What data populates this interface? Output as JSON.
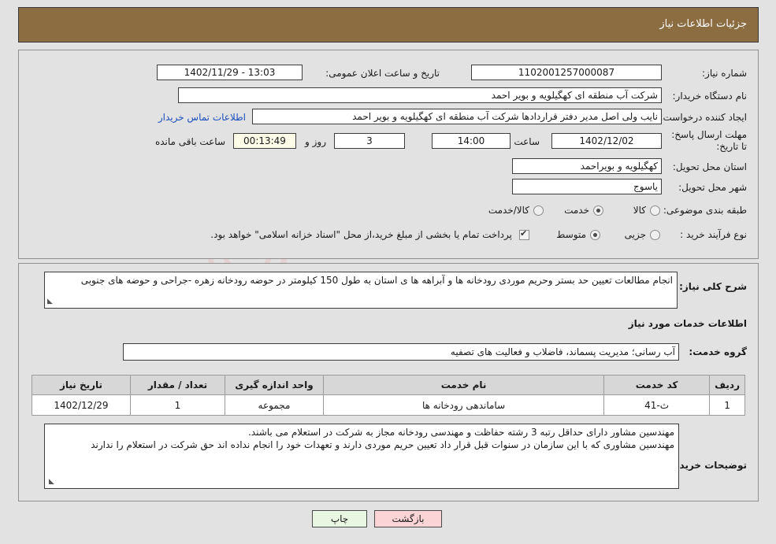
{
  "header": {
    "title": "جزئیات اطلاعات نیاز"
  },
  "watermark": {
    "text": "AriaTender.net"
  },
  "form": {
    "need_number_label": "شماره نیاز:",
    "need_number_value": "1102001257000087",
    "announce_label": "تاریخ و ساعت اعلان عمومی:",
    "announce_value": "13:03 - 1402/11/29",
    "buyer_org_label": "نام دستگاه خریدار:",
    "buyer_org_value": "شرکت آب منطقه ای کهگیلویه و بویر احمد",
    "creator_label": "ایجاد کننده درخواست:",
    "creator_value": "نایب ولی اصل مدیر دفتر قراردادها شرکت آب منطقه ای کهگیلویه و بویر احمد",
    "contact_link": "اطلاعات تماس خریدار",
    "deadline_label": "مهلت ارسال پاسخ: تا تاریخ:",
    "deadline_date": "1402/12/02",
    "hour_label": "ساعت",
    "hour_value": "14:00",
    "days_value": "3",
    "days_label": "روز و",
    "countdown_value": "00:13:49",
    "remaining_label": "ساعت باقی مانده",
    "province_label": "استان محل تحویل:",
    "province_value": "کهگیلویه و بویراحمد",
    "city_label": "شهر محل تحویل:",
    "city_value": "یاسوج",
    "category_label": "طبقه بندی موضوعی:",
    "category_options": [
      {
        "label": "کالا",
        "selected": false
      },
      {
        "label": "خدمت",
        "selected": true
      },
      {
        "label": "کالا/خدمت",
        "selected": false
      }
    ],
    "process_label": "نوع فرآیند خرید :",
    "process_options": [
      {
        "label": "جزیی",
        "selected": false
      },
      {
        "label": "متوسط",
        "selected": true
      }
    ],
    "treasury_checkbox_checked": true,
    "treasury_text": "پرداخت تمام یا بخشی از مبلغ خرید،از محل \"اسناد خزانه اسلامی\" خواهد بود."
  },
  "description": {
    "label": "شرح کلی نیاز:",
    "value": "انجام مطالعات تعیین حد بستر وحریم موردی رودخانه ها و آبراهه ها ی استان به طول 150 کیلومتر در حوضه رودخانه زهره -جراحی و حوضه های جنوبی"
  },
  "services_section": {
    "heading": "اطلاعات خدمات مورد نیاز",
    "group_label": "گروه خدمت:",
    "group_value": "آب رسانی؛ مدیریت پسماند، فاضلاب و فعالیت های تصفیه"
  },
  "table": {
    "columns": [
      "ردیف",
      "کد خدمت",
      "نام خدمت",
      "واحد اندازه گیری",
      "تعداد / مقدار",
      "تاریخ نیاز"
    ],
    "rows": [
      [
        "1",
        "ث-41",
        "ساماندهی رودخانه ها",
        "مجموعه",
        "1",
        "1402/12/29"
      ]
    ]
  },
  "notes": {
    "label": "توضیحات خریدار:",
    "value": "مهندسین مشاور دارای حداقل رتبه 3 رشته حفاظت و مهندسی رودخانه مجاز به شرکت در استعلام می باشند.\nمهندسین مشاوری که با این سازمان در سنوات قبل قرار داد تعیین حریم موردی دارند و تعهدات خود را انجام نداده اند حق شرکت در استعلام را ندارند"
  },
  "footer": {
    "back_button": "بازگشت",
    "print_button": "چاپ"
  },
  "colors": {
    "header_brown": "#8c6c41",
    "page_bg": "#e2e2e2",
    "link_blue": "#1b4fbe",
    "back_button_bg": "#fbd5d5",
    "print_button_bg": "#e9f7e2",
    "countdown_bg": "#fbfbe8"
  }
}
